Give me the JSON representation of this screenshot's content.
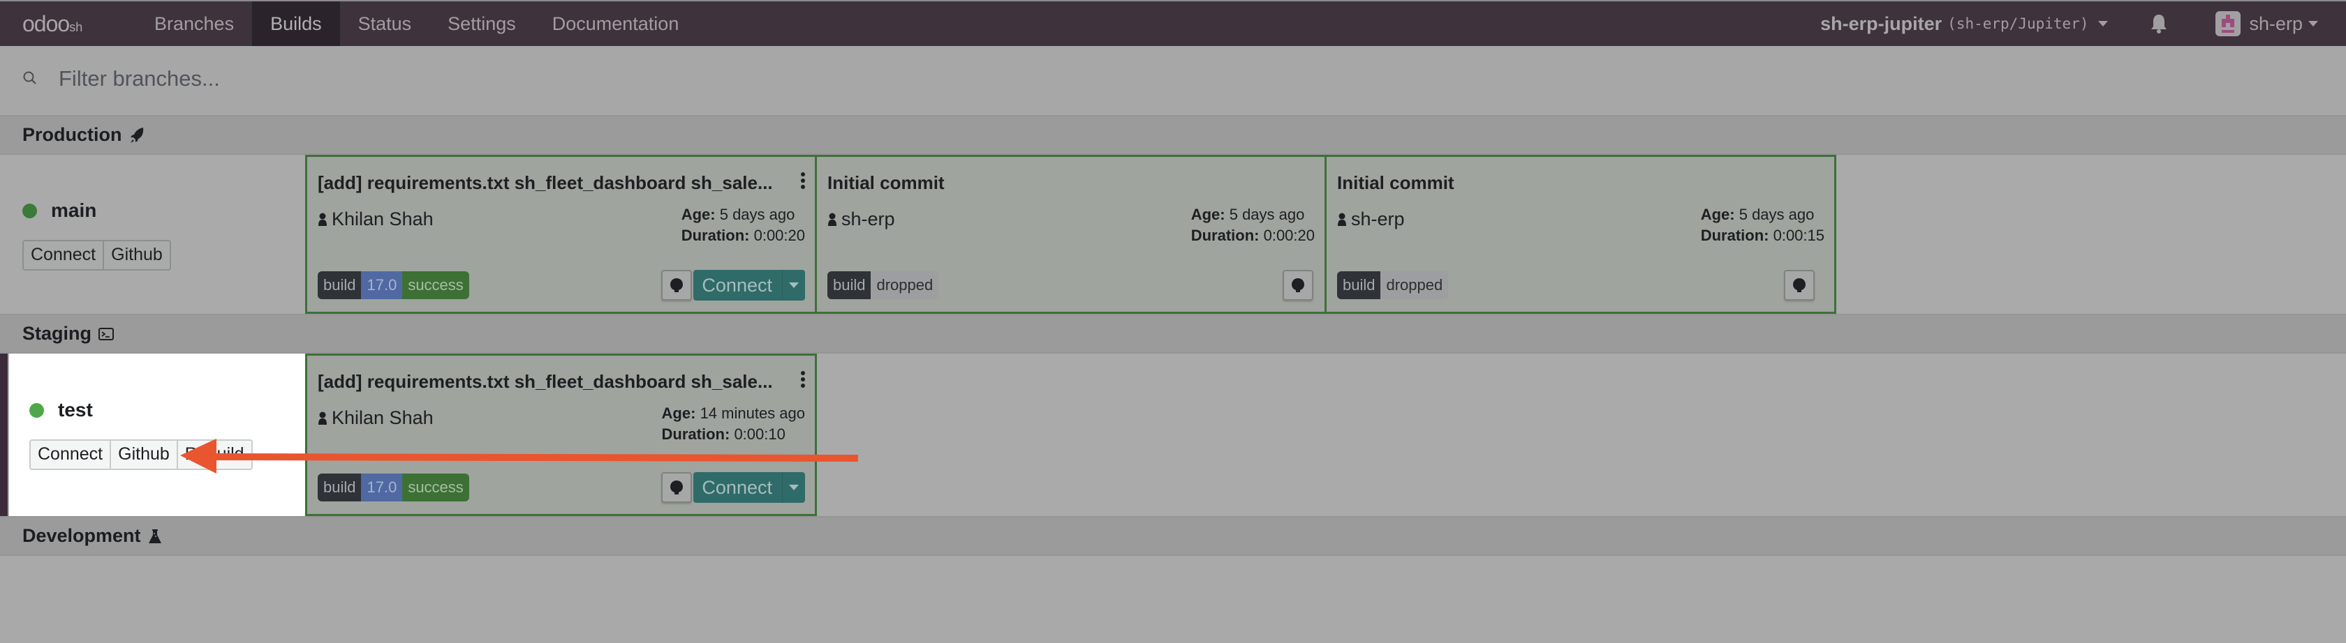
{
  "navbar": {
    "brand_main": "odoo",
    "brand_sub": "sh",
    "items": [
      {
        "label": "Branches",
        "active": false
      },
      {
        "label": "Builds",
        "active": true
      },
      {
        "label": "Status",
        "active": false
      },
      {
        "label": "Settings",
        "active": false
      },
      {
        "label": "Documentation",
        "active": false
      }
    ],
    "project_name": "sh-erp-jupiter",
    "project_repo": "(sh-erp/Jupiter)",
    "notifications_icon": "bell-icon",
    "user_name": "sh-erp"
  },
  "search": {
    "placeholder": "Filter branches...",
    "value": ""
  },
  "sections": {
    "production": {
      "title": "Production",
      "icon": "rocket-icon",
      "branch": {
        "name": "main",
        "status_color": "#3b7a39",
        "buttons": [
          "Connect",
          "Github"
        ]
      },
      "builds": [
        {
          "title": "[add] requirements.txt sh_fleet_dashboard sh_sale...",
          "author": "Khilan Shah",
          "age_label": "Age:",
          "age": "5 days ago",
          "duration_label": "Duration:",
          "duration": "0:00:20",
          "badges": [
            "build",
            "17.0",
            "success"
          ],
          "has_menu": true,
          "connect_label": "Connect"
        },
        {
          "title": "Initial commit",
          "author": "sh-erp",
          "age_label": "Age:",
          "age": "5 days ago",
          "duration_label": "Duration:",
          "duration": "0:00:20",
          "badges": [
            "build",
            "dropped"
          ],
          "has_menu": false
        },
        {
          "title": "Initial commit",
          "author": "sh-erp",
          "age_label": "Age:",
          "age": "5 days ago",
          "duration_label": "Duration:",
          "duration": "0:00:15",
          "badges": [
            "build",
            "dropped"
          ],
          "has_menu": false
        }
      ]
    },
    "staging": {
      "title": "Staging",
      "icon": "terminal-icon",
      "branch": {
        "name": "test",
        "status_color": "#4ea84a",
        "buttons": [
          "Connect",
          "Github",
          "Rebuild"
        ]
      },
      "builds": [
        {
          "title": "[add] requirements.txt sh_fleet_dashboard sh_sale...",
          "author": "Khilan Shah",
          "age_label": "Age:",
          "age": "14 minutes ago",
          "duration_label": "Duration:",
          "duration": "0:00:10",
          "badges": [
            "build",
            "17.0",
            "success"
          ],
          "has_menu": true,
          "connect_label": "Connect"
        }
      ]
    },
    "development": {
      "title": "Development",
      "icon": "flask-icon"
    }
  },
  "annotation": {
    "type": "arrow",
    "color": "#e9552f",
    "points_to": "staging-github-button"
  }
}
